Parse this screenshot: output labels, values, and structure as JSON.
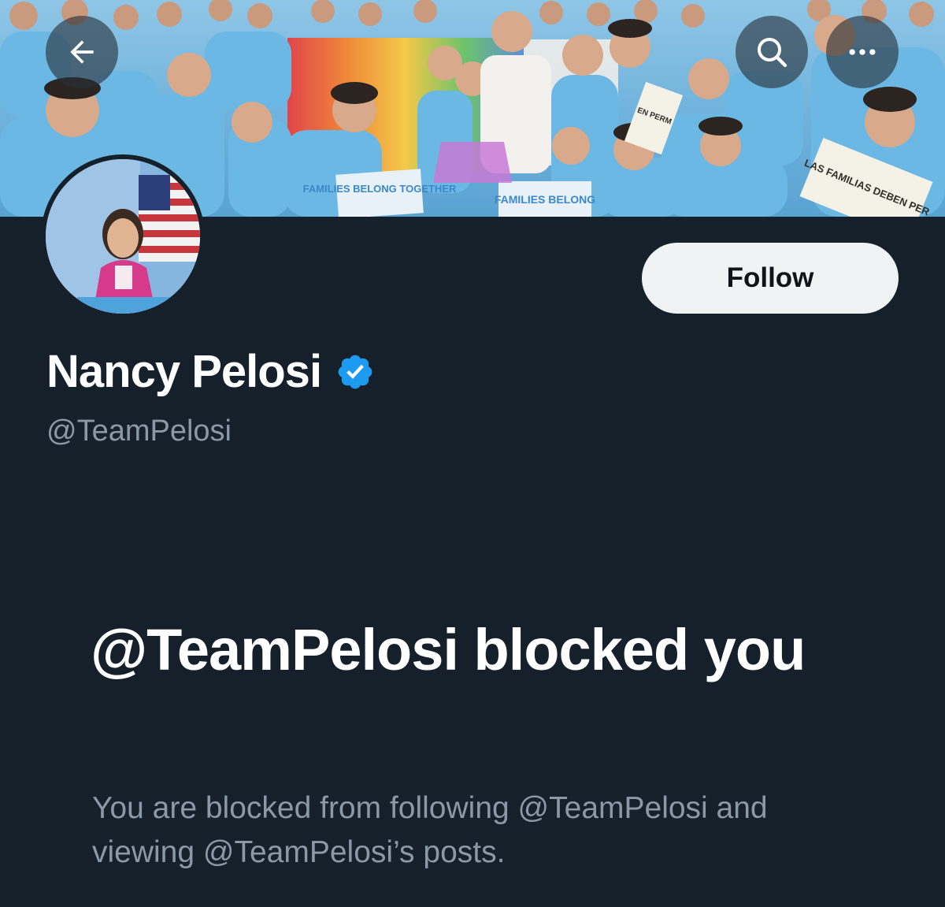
{
  "header": {
    "back_icon": "arrow-left-icon",
    "search_icon": "search-icon",
    "more_icon": "more-horizontal-icon"
  },
  "banner": {
    "signs": [
      "FAMILIES BELONG TOGETHER",
      "FAMILIES BELONG",
      "LAS FAMILIAS DEBEN PER",
      "EN PERM"
    ]
  },
  "profile": {
    "display_name": "Nancy Pelosi",
    "handle": "@TeamPelosi",
    "follow_label": "Follow",
    "verified_icon": "verified-badge-icon",
    "verified_color": "#1d9bf0"
  },
  "blocked": {
    "title": "@TeamPelosi blocked you",
    "description": "You are blocked from following @TeamPelosi and viewing @TeamPelosi’s posts."
  },
  "colors": {
    "background": "#15202b",
    "primary_text": "#ffffff",
    "secondary_text": "#8b98a5",
    "follow_bg": "#eff3f4",
    "follow_text": "#0f1419"
  }
}
